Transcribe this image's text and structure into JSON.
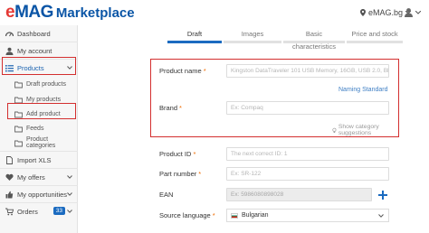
{
  "header": {
    "logo": "eMAG",
    "logo_suffix": "Marketplace",
    "store": "eMAG.bg"
  },
  "sidebar": {
    "items": [
      {
        "label": "Dashboard",
        "icon": "gauge-icon"
      },
      {
        "label": "My account",
        "icon": "user-icon"
      },
      {
        "label": "Products",
        "icon": "list-icon"
      },
      {
        "label": "Draft products",
        "icon": "folder-icon"
      },
      {
        "label": "My products",
        "icon": "folder-icon"
      },
      {
        "label": "Add product",
        "icon": "folder-icon"
      },
      {
        "label": "Feeds",
        "icon": "folder-icon"
      },
      {
        "label": "Product categories",
        "icon": "folder-icon"
      },
      {
        "label": "Import XLS",
        "icon": "file-icon"
      },
      {
        "label": "My offers",
        "icon": "heart-icon"
      },
      {
        "label": "My opportunities",
        "icon": "thumbs-up-icon"
      },
      {
        "label": "Orders",
        "icon": "cart-icon",
        "badge": "33"
      }
    ]
  },
  "tabs": [
    "Draft",
    "Images",
    "Basic characteristics",
    "Price and stock"
  ],
  "form1": {
    "product_name_label": "Product name",
    "product_name_placeholder": "Kingston DataTraveler 101 USB Memory, 16GB, USB 2.0, Black",
    "naming_standard": "Naming Standard",
    "brand_label": "Brand",
    "brand_placeholder": "Ex: Compaq",
    "show_suggestions": "Show category suggestions"
  },
  "form2": {
    "product_id_label": "Product ID",
    "product_id_placeholder": "The next correct ID: 1",
    "part_number_label": "Part number",
    "part_number_placeholder": "Ex: SR-122",
    "ean_label": "EAN",
    "ean_placeholder": "Ex: 5986080898028",
    "source_language_label": "Source language",
    "source_language_value": "Bulgarian"
  },
  "colors": {
    "brand_blue": "#0a55a6",
    "brand_red": "#e53935",
    "accent": "#1b6bc0",
    "highlight": "#d32f2f",
    "required": "#ef6c00"
  }
}
